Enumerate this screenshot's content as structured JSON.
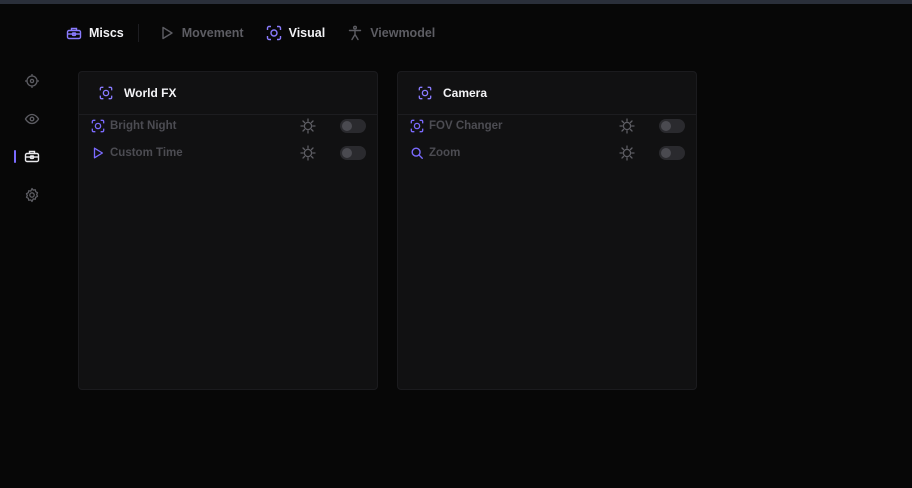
{
  "colors": {
    "accent": "#7b6bff",
    "background": "#070707",
    "panel": "#111112",
    "active_text": "#f2f2f5",
    "inactive_text": "#5d5d63"
  },
  "nav": {
    "tabs": [
      {
        "label": "Miscs",
        "icon": "toolbox-icon",
        "active": true
      },
      {
        "label": "Movement",
        "icon": "play-icon",
        "active": false
      },
      {
        "label": "Visual",
        "icon": "scan-face-icon",
        "active": true
      },
      {
        "label": "Viewmodel",
        "icon": "person-icon",
        "active": false
      }
    ]
  },
  "sidebar": {
    "items": [
      {
        "icon": "crosshair-icon",
        "active": false
      },
      {
        "icon": "eye-icon",
        "active": false
      },
      {
        "icon": "toolbox-icon",
        "active": true
      },
      {
        "icon": "gear-icon",
        "active": false
      }
    ]
  },
  "panels": [
    {
      "title": "World FX",
      "icon": "scan-face-icon",
      "rows": [
        {
          "label": "Bright Night",
          "icon": "scan-face-icon",
          "enabled": false
        },
        {
          "label": "Custom Time",
          "icon": "play-icon",
          "enabled": false
        }
      ]
    },
    {
      "title": "Camera",
      "icon": "scan-face-icon",
      "rows": [
        {
          "label": "FOV Changer",
          "icon": "scan-face-icon",
          "enabled": false
        },
        {
          "label": "Zoom",
          "icon": "search-icon",
          "enabled": false
        }
      ]
    }
  ]
}
